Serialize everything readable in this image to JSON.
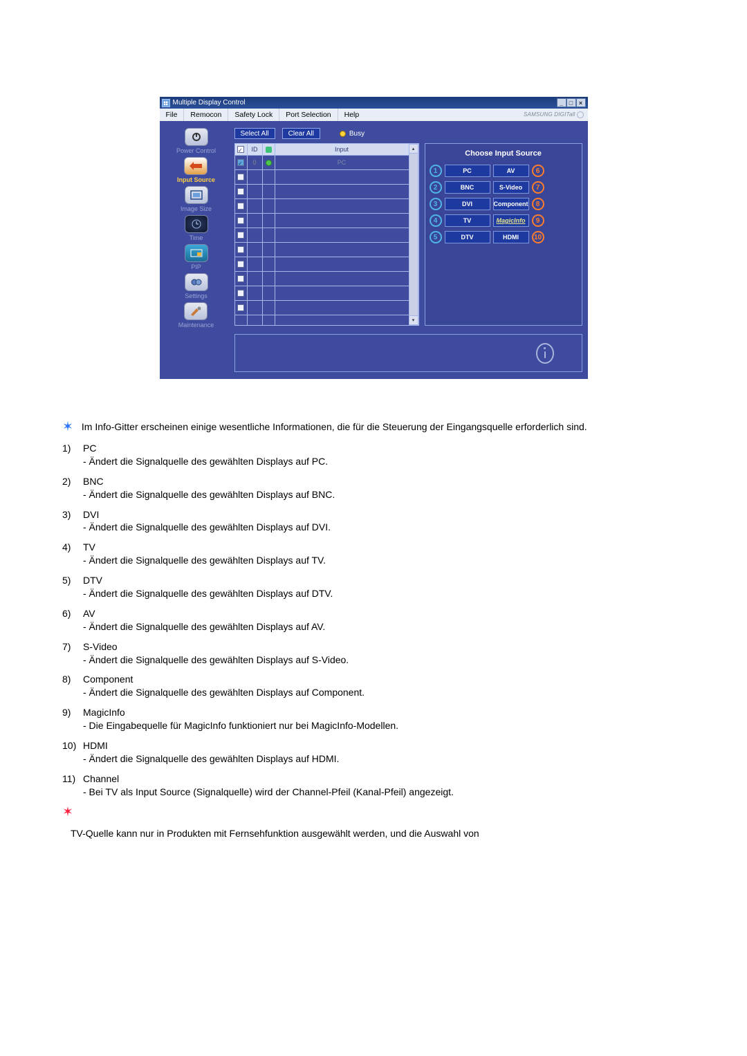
{
  "window": {
    "title": "Multiple Display Control",
    "menus": [
      "File",
      "Remocon",
      "Safety Lock",
      "Port Selection",
      "Help"
    ],
    "brand": "SAMSUNG DIGITall"
  },
  "sidebar": [
    {
      "label": "Power Control"
    },
    {
      "label": "Input Source",
      "active": true
    },
    {
      "label": "Image Size"
    },
    {
      "label": "Time"
    },
    {
      "label": "PIP"
    },
    {
      "label": "Settings"
    },
    {
      "label": "Maintenance"
    }
  ],
  "toolbar": {
    "select_all": "Select All",
    "clear_all": "Clear All",
    "busy": "Busy"
  },
  "grid": {
    "headers": {
      "id": "ID",
      "input": "Input"
    },
    "first_row": {
      "id": "0",
      "input": "PC"
    }
  },
  "panel": {
    "title": "Choose Input Source",
    "items": [
      {
        "n": "1",
        "label": "PC"
      },
      {
        "n": "6",
        "label": "AV"
      },
      {
        "n": "2",
        "label": "BNC"
      },
      {
        "n": "7",
        "label": "S-Video"
      },
      {
        "n": "3",
        "label": "DVI"
      },
      {
        "n": "8",
        "label": "Component"
      },
      {
        "n": "4",
        "label": "TV"
      },
      {
        "n": "9",
        "label": "MagicInfo",
        "magic": true
      },
      {
        "n": "5",
        "label": "DTV"
      },
      {
        "n": "10",
        "label": "HDMI"
      }
    ]
  },
  "doc": {
    "intro": "Im Info-Gitter erscheinen einige wesentliche Informationen, die für die Steuerung der Eingangsquelle erforderlich sind.",
    "items": [
      {
        "n": "1)",
        "title": "PC",
        "desc": "- Ändert die Signalquelle des gewählten Displays auf PC."
      },
      {
        "n": "2)",
        "title": "BNC",
        "desc": "- Ändert die Signalquelle des gewählten Displays auf BNC."
      },
      {
        "n": "3)",
        "title": "DVI",
        "desc": "- Ändert die Signalquelle des gewählten Displays auf DVI."
      },
      {
        "n": "4)",
        "title": "TV",
        "desc": "- Ändert die Signalquelle des gewählten Displays auf TV."
      },
      {
        "n": "5)",
        "title": "DTV",
        "desc": "- Ändert die Signalquelle des gewählten Displays auf DTV."
      },
      {
        "n": "6)",
        "title": "AV",
        "desc": "- Ändert die Signalquelle des gewählten Displays auf AV."
      },
      {
        "n": "7)",
        "title": "S-Video",
        "desc": "- Ändert die Signalquelle des gewählten Displays auf S-Video."
      },
      {
        "n": "8)",
        "title": "Component",
        "desc": "- Ändert die Signalquelle des gewählten Displays auf Component."
      },
      {
        "n": "9)",
        "title": "MagicInfo",
        "desc": "- Die Eingabequelle für MagicInfo funktioniert nur bei MagicInfo-Modellen."
      },
      {
        "n": "10)",
        "title": "HDMI",
        "desc": "- Ändert die Signalquelle des gewählten Displays auf HDMI."
      },
      {
        "n": "11)",
        "title": "Channel",
        "desc": "- Bei TV als Input Source (Signalquelle) wird der Channel-Pfeil (Kanal-Pfeil) angezeigt."
      }
    ],
    "final": "TV-Quelle kann nur in Produkten mit Fernsehfunktion ausgewählt werden, und die Auswahl von"
  }
}
